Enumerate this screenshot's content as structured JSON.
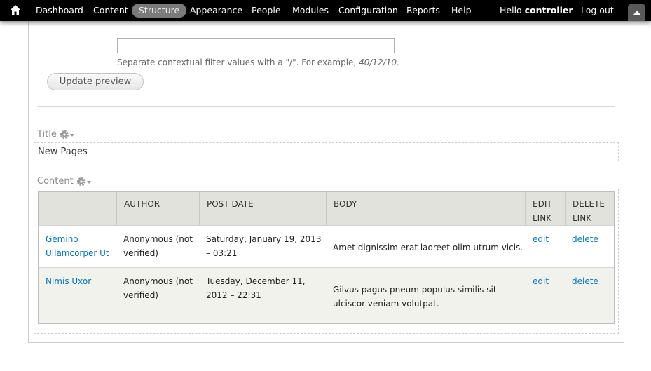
{
  "toolbar": {
    "items": [
      {
        "label": "Dashboard"
      },
      {
        "label": "Content"
      },
      {
        "label": "Structure",
        "active": true
      },
      {
        "label": "Appearance"
      },
      {
        "label": "People"
      },
      {
        "label": "Modules"
      },
      {
        "label": "Configuration"
      },
      {
        "label": "Reports"
      },
      {
        "label": "Help"
      }
    ],
    "hello_prefix": "Hello ",
    "username": "controller",
    "logout": "Log out",
    "home_icon": "home-icon",
    "toggle_icon": "caret-up-icon"
  },
  "preview": {
    "filter_value": "",
    "filter_desc_prefix": "Separate contextual filter values with a \"/\". For example, ",
    "filter_desc_example": "40/12/10",
    "filter_desc_suffix": ".",
    "update_button": "Update preview"
  },
  "title_section": {
    "label": "Title",
    "value": "New Pages",
    "icon": "gear-icon"
  },
  "content_section": {
    "label": "Content",
    "icon": "gear-icon",
    "headers": [
      "",
      "AUTHOR",
      "POST DATE",
      "BODY",
      "EDIT LINK",
      "DELETE LINK"
    ],
    "rows": [
      {
        "title": "Gemino Ullamcorper Ut",
        "author": "Anonymous (not verified)",
        "post_date": "Saturday, January 19, 2013 – 03:21",
        "body": "Amet dignissim erat laoreet olim utrum vicis.",
        "edit": "edit",
        "delete": "delete"
      },
      {
        "title": "Nimis Uxor",
        "author": "Anonymous (not verified)",
        "post_date": "Tuesday, December 11, 2012 – 22:31",
        "body": "Gilvus pagus pneum populus similis sit ulciscor veniam volutpat.",
        "edit": "edit",
        "delete": "delete"
      }
    ]
  },
  "colors": {
    "toolbar_bg": "#000000",
    "active_tab": "#7a7a7a",
    "link": "#0074bd",
    "table_header": "#e1e2dc",
    "row_alt": "#f2f2ed"
  }
}
